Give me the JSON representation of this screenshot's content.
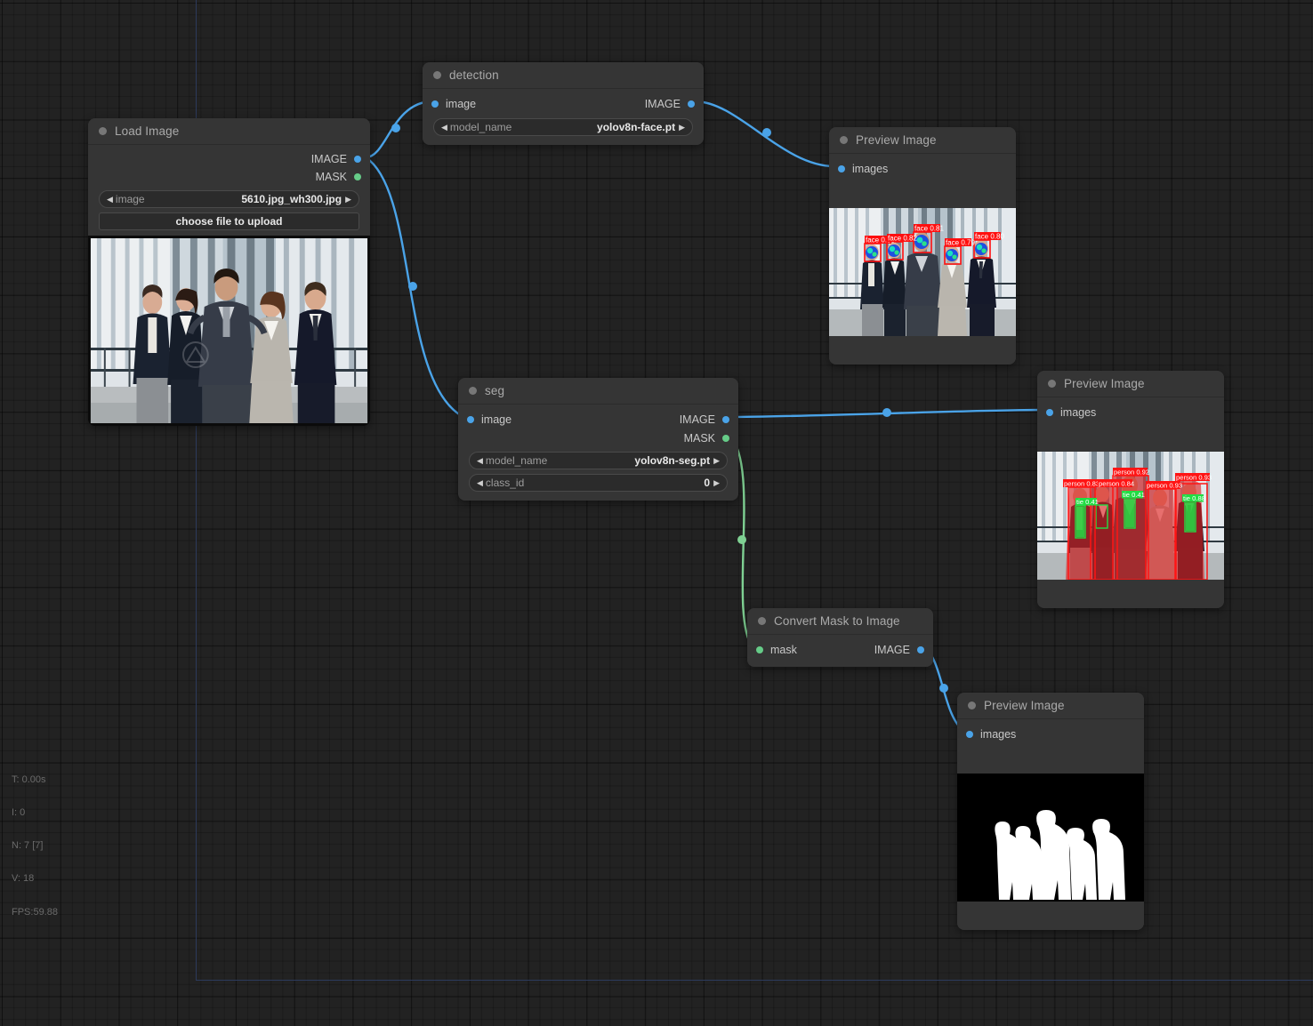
{
  "app": {
    "background_color": "#222222",
    "node_color": "#353535",
    "link_image_color": "#4aa3e8",
    "link_mask_color": "#66cc88"
  },
  "status": {
    "time": "T: 0.00s",
    "iterations": "I: 0",
    "nodes": "N: 7 [7]",
    "vertices": "V: 18",
    "fps": "FPS:59.88"
  },
  "nodes": {
    "load_image": {
      "title": "Load Image",
      "outputs": [
        {
          "label": "IMAGE",
          "type": "image"
        },
        {
          "label": "MASK",
          "type": "mask"
        }
      ],
      "widgets": [
        {
          "name": "image",
          "value": "5610.jpg_wh300.jpg"
        }
      ],
      "button": "choose file to upload"
    },
    "detection": {
      "title": "detection",
      "inputs": [
        {
          "label": "image",
          "type": "image"
        }
      ],
      "outputs": [
        {
          "label": "IMAGE",
          "type": "image"
        }
      ],
      "widgets": [
        {
          "name": "model_name",
          "value": "yolov8n-face.pt"
        }
      ]
    },
    "seg": {
      "title": "seg",
      "inputs": [
        {
          "label": "image",
          "type": "image"
        }
      ],
      "outputs": [
        {
          "label": "IMAGE",
          "type": "image"
        },
        {
          "label": "MASK",
          "type": "mask"
        }
      ],
      "widgets": [
        {
          "name": "model_name",
          "value": "yolov8n-seg.pt"
        },
        {
          "name": "class_id",
          "value": "0"
        }
      ]
    },
    "convert_mask": {
      "title": "Convert Mask to Image",
      "inputs": [
        {
          "label": "mask",
          "type": "mask"
        }
      ],
      "outputs": [
        {
          "label": "IMAGE",
          "type": "image"
        }
      ]
    },
    "preview_faces": {
      "title": "Preview Image",
      "inputs": [
        {
          "label": "images",
          "type": "image"
        }
      ]
    },
    "preview_seg": {
      "title": "Preview Image",
      "inputs": [
        {
          "label": "images",
          "type": "image"
        }
      ]
    },
    "preview_mask": {
      "title": "Preview Image",
      "inputs": [
        {
          "label": "images",
          "type": "image"
        }
      ]
    }
  },
  "detections": {
    "faces": [
      {
        "label": "face 0.83"
      },
      {
        "label": "face 0.82"
      },
      {
        "label": "face 0.81"
      },
      {
        "label": "face 0.79"
      },
      {
        "label": "face 0.80"
      }
    ],
    "segments": [
      {
        "label": "person 0.83"
      },
      {
        "label": "person 0.84"
      },
      {
        "label": "person 0.92"
      },
      {
        "label": "person 0.93"
      },
      {
        "label": "person 0.93"
      },
      {
        "label": "tie 0.41"
      },
      {
        "label": "tie 0.41"
      },
      {
        "label": "tie 0.88"
      }
    ]
  }
}
